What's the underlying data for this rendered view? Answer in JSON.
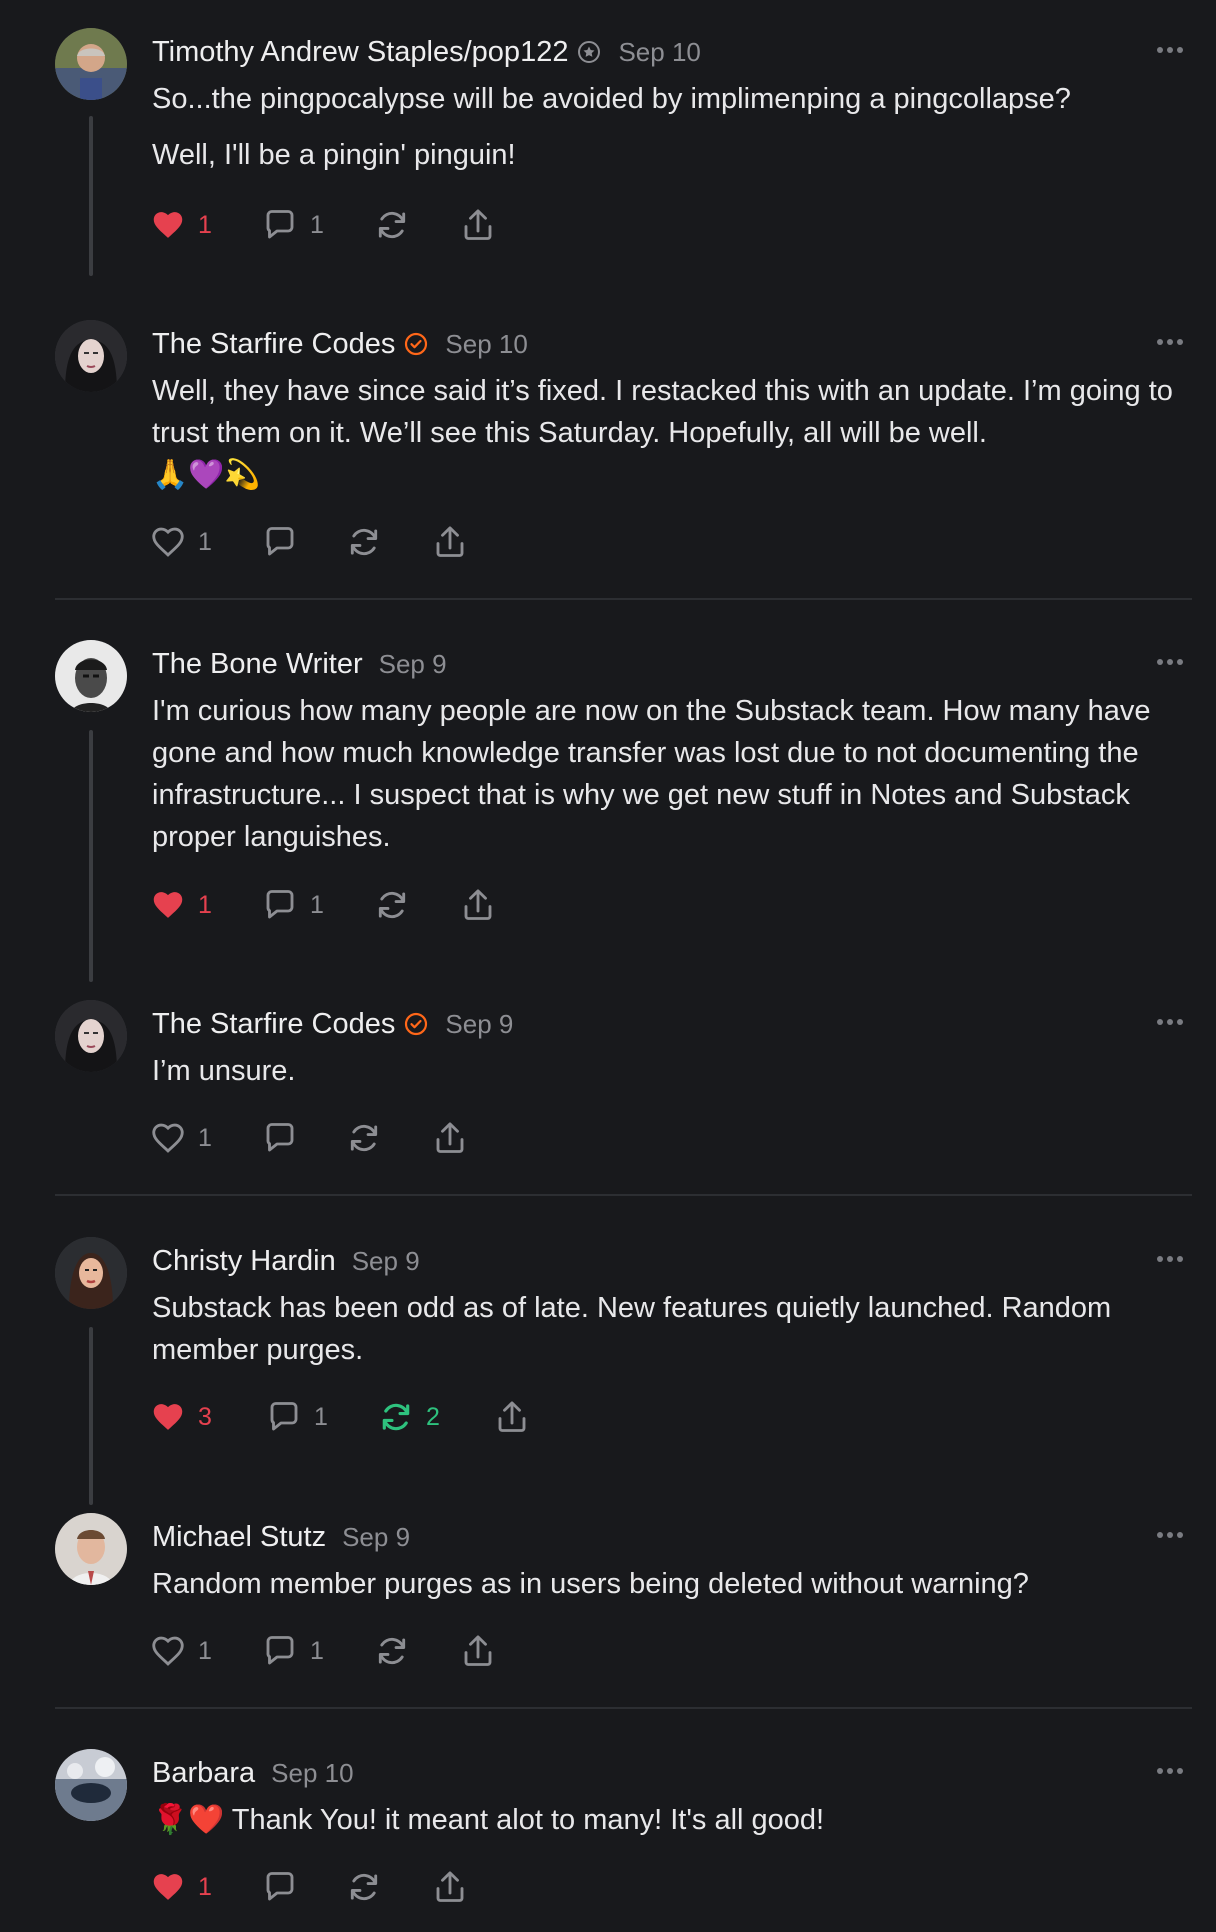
{
  "comments": [
    {
      "author": "Timothy Andrew Staples/pop122",
      "date": "Sep 10",
      "paragraphs": [
        "So...the pingpocalypse will be avoided by implimenping a pingcollapse?",
        "Well, I'll be a pingin' pinguin!"
      ],
      "likes": "1",
      "liked": true,
      "replies": "1",
      "restacks": ""
    },
    {
      "author": "The Starfire Codes",
      "date": "Sep 10",
      "paragraphs": [
        "Well, they have since said it’s fixed. I restacked this with an update. I’m going to trust them on it. We’ll see this Saturday. Hopefully, all will be well.",
        "🙏💜💫"
      ],
      "likes": "1",
      "liked": false,
      "replies": "",
      "restacks": ""
    },
    {
      "author": "The Bone Writer",
      "date": "Sep 9",
      "paragraphs": [
        "I'm curious how many people are now on the Substack team. How many have gone and how much knowledge transfer was lost due to not documenting the infrastructure... I suspect that is why we get new stuff in Notes and Substack proper languishes."
      ],
      "likes": "1",
      "liked": true,
      "replies": "1",
      "restacks": ""
    },
    {
      "author": "The Starfire Codes",
      "date": "Sep 9",
      "paragraphs": [
        "I’m unsure."
      ],
      "likes": "1",
      "liked": false,
      "replies": "",
      "restacks": ""
    },
    {
      "author": "Christy Hardin",
      "date": "Sep 9",
      "paragraphs": [
        "Substack has been odd as of late. New features quietly launched. Random member purges."
      ],
      "likes": "3",
      "liked": true,
      "replies": "1",
      "restacks": "2"
    },
    {
      "author": "Michael Stutz",
      "date": "Sep 9",
      "paragraphs": [
        "Random member purges as in users being deleted without warning?"
      ],
      "likes": "1",
      "liked": false,
      "replies": "1",
      "restacks": ""
    },
    {
      "author": "Barbara",
      "date": "Sep 10",
      "paragraphs": [
        "🌹❤️ Thank You! it meant alot to many! It's all good!"
      ],
      "likes": "1",
      "liked": true,
      "replies": "",
      "restacks": ""
    }
  ],
  "colors": {
    "background": "#18191c",
    "like_active": "#e6414f",
    "restack_active": "#2ec27e",
    "verified_badge": "#ff6719",
    "muted": "#8d8e93"
  },
  "icons": [
    "heart-icon",
    "comment-icon",
    "restack-icon",
    "share-icon",
    "more-icon",
    "verified-badge-icon",
    "pledge-badge-icon"
  ]
}
